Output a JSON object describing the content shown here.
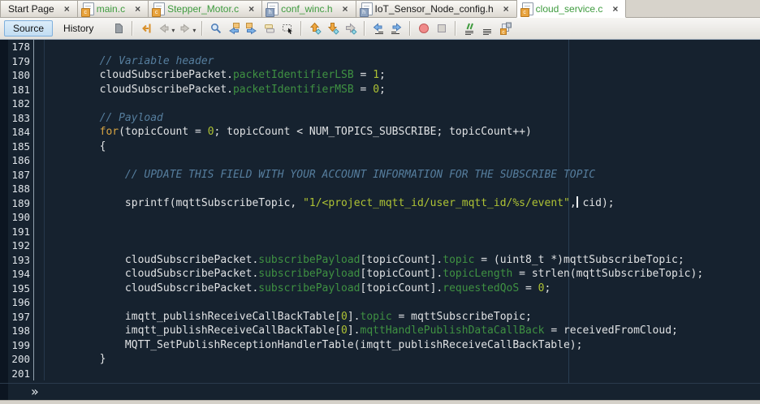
{
  "colors": {
    "editor_bg": "#16222F",
    "gutter_text": "#DFE4E9",
    "code_default": "#E0E2E4",
    "comment": "#567E9E",
    "keyword": "#D7A443",
    "literal": "#AEC234",
    "member": "#3F9142",
    "modified_tab": "#3E9B3E",
    "margin_guide": "#2A3E52"
  },
  "tabs": [
    {
      "label": "Start Page",
      "icon": null,
      "modified": false,
      "active": false
    },
    {
      "label": "main.c",
      "icon": "c",
      "modified": true,
      "active": false
    },
    {
      "label": "Stepper_Motor.c",
      "icon": "c",
      "modified": true,
      "active": false
    },
    {
      "label": "conf_winc.h",
      "icon": "h",
      "modified": true,
      "active": false
    },
    {
      "label": "IoT_Sensor_Node_config.h",
      "icon": "h",
      "modified": false,
      "active": false
    },
    {
      "label": "cloud_service.c",
      "icon": "c",
      "modified": true,
      "active": true
    }
  ],
  "toolbar": {
    "source_label": "Source",
    "history_label": "History",
    "icon_groups": [
      [
        "format"
      ],
      [
        "last-edit-location",
        "back",
        "forward"
      ],
      [
        "find-selection",
        "find-previous",
        "find-next",
        "toggle-highlight-search",
        "rectangular-selection"
      ],
      [
        "previous-bookmark",
        "next-bookmark",
        "toggle-bookmark"
      ],
      [
        "shift-line-left",
        "shift-line-right"
      ],
      [
        "start-macro-recording",
        "stop-macro-recording"
      ],
      [
        "comment",
        "uncomment",
        "toggle-header-source"
      ]
    ]
  },
  "breadcrumb": {
    "expand_glyph": "»"
  },
  "editor": {
    "lines": [
      {
        "n": "178",
        "tokens": []
      },
      {
        "n": "179",
        "tokens": [
          [
            "cmt",
            "        // Variable header"
          ]
        ]
      },
      {
        "n": "180",
        "tokens": [
          [
            "def",
            "        cloudSubscribePacket."
          ],
          [
            "mem",
            "packetIdentifierLSB"
          ],
          [
            "def",
            " = "
          ],
          [
            "lit",
            "1"
          ],
          [
            "def",
            ";"
          ]
        ]
      },
      {
        "n": "181",
        "tokens": [
          [
            "def",
            "        cloudSubscribePacket."
          ],
          [
            "mem",
            "packetIdentifierMSB"
          ],
          [
            "def",
            " = "
          ],
          [
            "lit",
            "0"
          ],
          [
            "def",
            ";"
          ]
        ]
      },
      {
        "n": "182",
        "tokens": []
      },
      {
        "n": "183",
        "tokens": [
          [
            "cmt",
            "        // Payload"
          ]
        ]
      },
      {
        "n": "184",
        "tokens": [
          [
            "def",
            "        "
          ],
          [
            "kw",
            "for"
          ],
          [
            "def",
            "(topicCount = "
          ],
          [
            "lit",
            "0"
          ],
          [
            "def",
            "; topicCount < NUM_TOPICS_SUBSCRIBE; topicCount++)"
          ]
        ]
      },
      {
        "n": "185",
        "tokens": [
          [
            "def",
            "        {"
          ]
        ]
      },
      {
        "n": "186",
        "tokens": []
      },
      {
        "n": "187",
        "tokens": [
          [
            "cmt",
            "            // UPDATE THIS FIELD WITH YOUR ACCOUNT INFORMATION FOR THE SUBSCRIBE TOPIC"
          ]
        ]
      },
      {
        "n": "188",
        "tokens": []
      },
      {
        "n": "189",
        "tokens": [
          [
            "def",
            "            sprintf(mqttSubscribeTopic, "
          ],
          [
            "str",
            "\"1/<project_mqtt_id/user_mqtt_id/%s/event\""
          ],
          [
            "def",
            ","
          ],
          [
            "caret",
            ""
          ],
          [
            "def",
            " cid);"
          ]
        ]
      },
      {
        "n": "190",
        "tokens": []
      },
      {
        "n": "191",
        "tokens": []
      },
      {
        "n": "192",
        "tokens": []
      },
      {
        "n": "193",
        "tokens": [
          [
            "def",
            "            cloudSubscribePacket."
          ],
          [
            "mem",
            "subscribePayload"
          ],
          [
            "def",
            "[topicCount]."
          ],
          [
            "mem",
            "topic"
          ],
          [
            "def",
            " = (uint8_t *)mqttSubscribeTopic;"
          ]
        ]
      },
      {
        "n": "194",
        "tokens": [
          [
            "def",
            "            cloudSubscribePacket."
          ],
          [
            "mem",
            "subscribePayload"
          ],
          [
            "def",
            "[topicCount]."
          ],
          [
            "mem",
            "topicLength"
          ],
          [
            "def",
            " = strlen(mqttSubscribeTopic);"
          ]
        ]
      },
      {
        "n": "195",
        "tokens": [
          [
            "def",
            "            cloudSubscribePacket."
          ],
          [
            "mem",
            "subscribePayload"
          ],
          [
            "def",
            "[topicCount]."
          ],
          [
            "mem",
            "requestedQoS"
          ],
          [
            "def",
            " = "
          ],
          [
            "lit",
            "0"
          ],
          [
            "def",
            ";"
          ]
        ]
      },
      {
        "n": "196",
        "tokens": []
      },
      {
        "n": "197",
        "tokens": [
          [
            "def",
            "            imqtt_publishReceiveCallBackTable["
          ],
          [
            "lit",
            "0"
          ],
          [
            "def",
            "]."
          ],
          [
            "mem",
            "topic"
          ],
          [
            "def",
            " = mqttSubscribeTopic;"
          ]
        ]
      },
      {
        "n": "198",
        "tokens": [
          [
            "def",
            "            imqtt_publishReceiveCallBackTable["
          ],
          [
            "lit",
            "0"
          ],
          [
            "def",
            "]."
          ],
          [
            "mem",
            "mqttHandlePublishDataCallBack"
          ],
          [
            "def",
            " = receivedFromCloud;"
          ]
        ]
      },
      {
        "n": "199",
        "tokens": [
          [
            "def",
            "            MQTT_SetPublishReceptionHandlerTable(imqtt_publishReceiveCallBackTable);"
          ]
        ]
      },
      {
        "n": "200",
        "tokens": [
          [
            "def",
            "        }"
          ]
        ]
      },
      {
        "n": "201",
        "tokens": []
      }
    ]
  }
}
